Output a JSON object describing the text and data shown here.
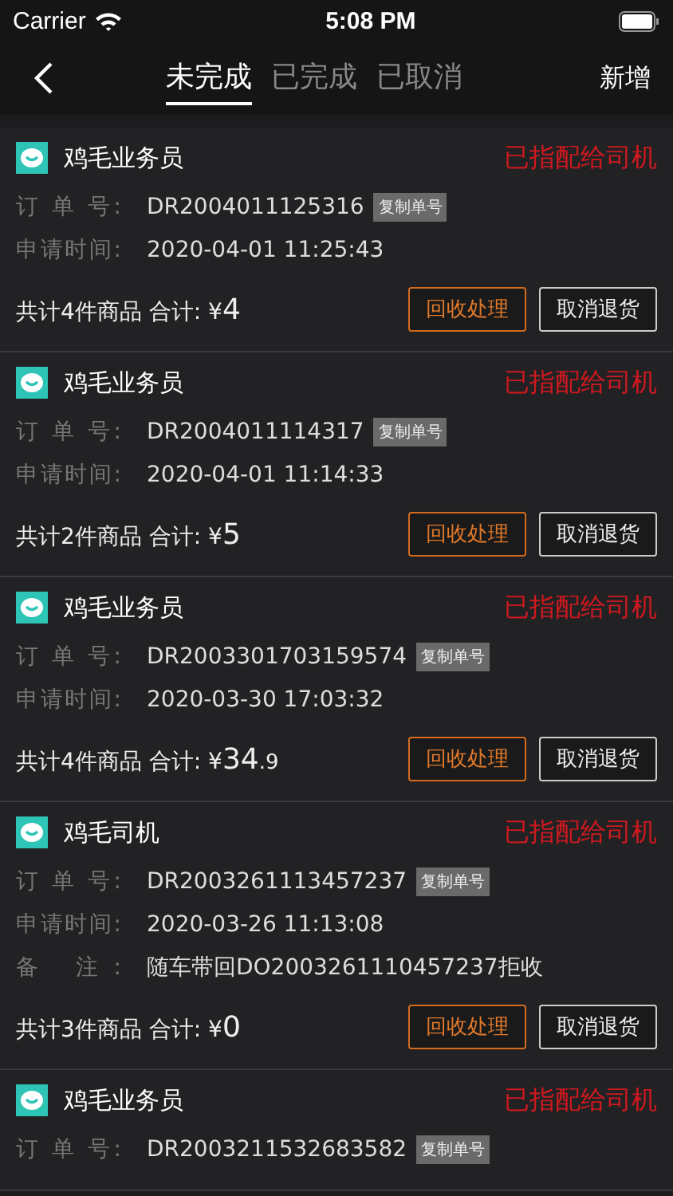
{
  "status_bar": {
    "carrier": "Carrier",
    "time": "5:08 PM"
  },
  "nav": {
    "tabs": [
      {
        "label": "未完成",
        "selected": true
      },
      {
        "label": "已完成",
        "selected": false
      },
      {
        "label": "已取消",
        "selected": false
      }
    ],
    "action": "新增"
  },
  "orders": [
    {
      "name": "鸡毛业务员",
      "status": "已指配给司机",
      "fields": [
        {
          "kind": "order",
          "label": "订 单 号:",
          "value": "DR2004011125316",
          "copy": "复制单号"
        },
        {
          "kind": "plain",
          "label": "申请时间:",
          "value": "2020-04-01 11:25:43"
        }
      ],
      "summary": "共计4件商品 合计: ¥",
      "amount": "4",
      "buttons": [
        "回收处理",
        "取消退货"
      ]
    },
    {
      "name": "鸡毛业务员",
      "status": "已指配给司机",
      "fields": [
        {
          "kind": "order",
          "label": "订 单 号:",
          "value": "DR2004011114317",
          "copy": "复制单号"
        },
        {
          "kind": "plain",
          "label": "申请时间:",
          "value": "2020-04-01 11:14:33"
        }
      ],
      "summary": "共计2件商品 合计: ¥",
      "amount": "5",
      "buttons": [
        "回收处理",
        "取消退货"
      ]
    },
    {
      "name": "鸡毛业务员",
      "status": "已指配给司机",
      "fields": [
        {
          "kind": "order",
          "label": "订 单 号:",
          "value": "DR2003301703159574",
          "copy": "复制单号"
        },
        {
          "kind": "plain",
          "label": "申请时间:",
          "value": "2020-03-30 17:03:32"
        }
      ],
      "summary": "共计4件商品 合计: ¥",
      "amount": "34",
      "amount_fraction": ".9",
      "buttons": [
        "回收处理",
        "取消退货"
      ]
    },
    {
      "name": "鸡毛司机",
      "status": "已指配给司机",
      "fields": [
        {
          "kind": "order",
          "label": "订 单 号:",
          "value": "DR2003261113457237",
          "copy": "复制单号"
        },
        {
          "kind": "plain",
          "label": "申请时间:",
          "value": "2020-03-26 11:13:08"
        },
        {
          "kind": "plain",
          "label": "备 注:",
          "value": "随车带回DO2003261110457237拒收"
        }
      ],
      "summary": "共计3件商品 合计: ¥",
      "amount": "0",
      "buttons": [
        "回收处理",
        "取消退货"
      ]
    },
    {
      "name": "鸡毛业务员",
      "status": "已指配给司机",
      "fields": [
        {
          "kind": "order",
          "label": "订 单 号:",
          "value": "DR2003211532683582",
          "copy": "复制单号"
        }
      ]
    }
  ]
}
